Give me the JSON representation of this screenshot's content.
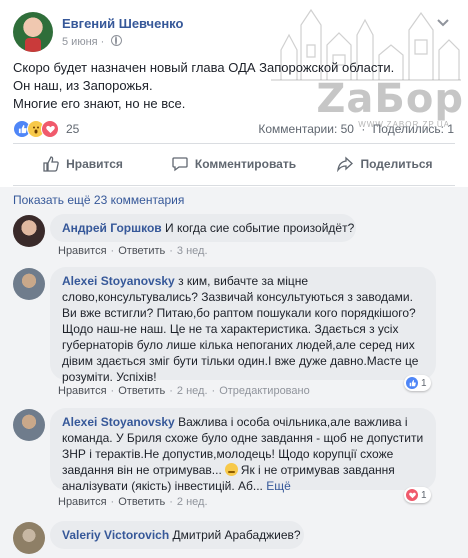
{
  "post": {
    "author": "Евгений Шевченко",
    "date": "5 июня",
    "lines": [
      "Скоро будет назначен новый глава ОДА Запорожской области.",
      "Он наш, из Запорожья.",
      "Многие его знают, но не все."
    ],
    "reaction_icons": [
      "like-icon",
      "wow-icon",
      "love-icon"
    ],
    "reaction_count": "25",
    "comments_count": "Комментарии: 50",
    "shares_count": "Поделились: 1"
  },
  "watermark": {
    "title": "ZaБор",
    "url": "WWW.ZABOR.ZP.UA"
  },
  "actions": {
    "like": "Нравится",
    "comment": "Комментировать",
    "share": "Поделиться"
  },
  "show_more": "Показать ещё 23 комментария",
  "comments": [
    {
      "author": "Андрей Горшков",
      "lines": [
        "И когда сие событие произойдёт?"
      ],
      "like": "Нравится",
      "reply": "Ответить",
      "time": "3 нед."
    },
    {
      "author": "Alexei Stoyanovsky",
      "lines": [
        "з ким, вибачте за міцне",
        "слово,консультувались? Зазвичай консультуються з заводами.",
        "Ви вже встигли? Питаю,бо раптом пошукали кого порядкішого?",
        "Щодо наш-не наш. Це не та характеристика. Здається з усіх",
        "губернаторів було лише кілька непоганих людей,але серед них",
        "дівим здається зміг бути тільки один.І вже дуже давно.Масте це",
        "розуміти. Успіхів!"
      ],
      "like": "Нравится",
      "reply": "Ответить",
      "time": "2 нед.",
      "edited": "Отредактировано",
      "reaction_count": "1"
    },
    {
      "author": "Alexei Stoyanovsky",
      "lines": [
        "Важлива і особа очільника,але важлива і",
        "команда. У Бриля схоже було одне завдання - щоб не допустити",
        "ЗНР і терактів.Не допустив,молодець! Щодо корупції схоже",
        "завдання він не отримував...",
        "Як і не отримував завдання",
        "аналізувати (якість) інвестицій. Аб...",
        "Ещё"
      ],
      "like": "Нравится",
      "reply": "Ответить",
      "time": "2 нед.",
      "reaction_count": "1"
    },
    {
      "author": "Valeriy Victorovich",
      "lines": [
        "Дмитрий Арабаджиев?"
      ]
    }
  ]
}
